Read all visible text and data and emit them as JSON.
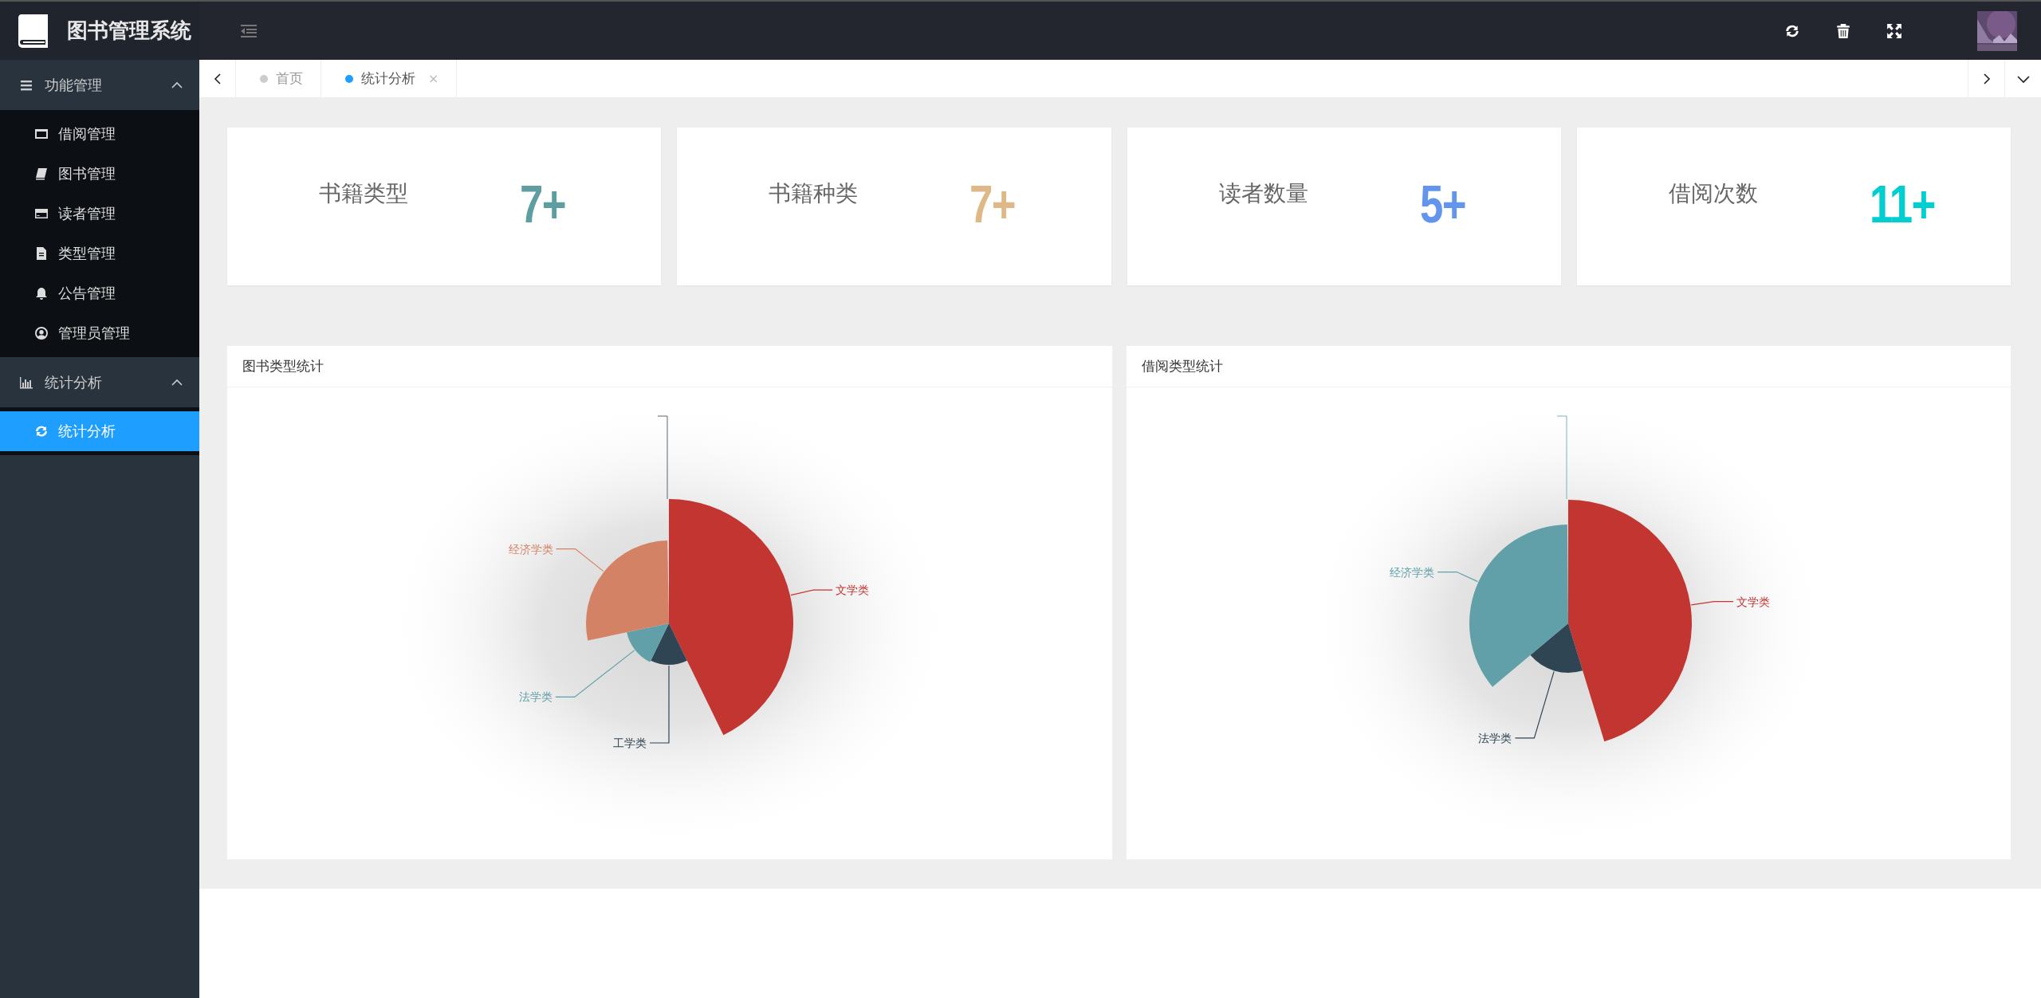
{
  "app_title": "图书管理系统",
  "sidebar": [
    {
      "label": "功能管理",
      "expanded": true,
      "children": [
        {
          "label": "借阅管理",
          "selected": false
        },
        {
          "label": "图书管理",
          "selected": false
        },
        {
          "label": "读者管理",
          "selected": false
        },
        {
          "label": "类型管理",
          "selected": false
        },
        {
          "label": "公告管理",
          "selected": false
        },
        {
          "label": "管理员管理",
          "selected": false
        }
      ]
    },
    {
      "label": "统计分析",
      "expanded": true,
      "children": [
        {
          "label": "统计分析",
          "selected": true
        }
      ]
    }
  ],
  "tabs": [
    {
      "label": "首页",
      "selected": false
    },
    {
      "label": "统计分析",
      "selected": true,
      "close": "×"
    }
  ],
  "stats": [
    {
      "label": "书籍类型",
      "value": "7+",
      "color": "#5f9ea0"
    },
    {
      "label": "书籍种类",
      "value": "7+",
      "color": "#deb887"
    },
    {
      "label": "读者数量",
      "value": "5+",
      "color": "#6495ed"
    },
    {
      "label": "借阅次数",
      "value": "11+",
      "color": "#00ced1"
    }
  ],
  "charts": [
    {
      "title": "图书类型统计",
      "slices": [
        {
          "label": "文学类",
          "color": "#c23531"
        },
        {
          "label": "工学类",
          "color": "#2f4554"
        },
        {
          "label": "法学类",
          "color": "#61a0a8"
        },
        {
          "label": "经济学类",
          "color": "#d48265"
        }
      ]
    },
    {
      "title": "借阅类型统计",
      "slices": [
        {
          "label": "文学类",
          "color": "#c23531"
        },
        {
          "label": "法学类",
          "color": "#2f4554"
        },
        {
          "label": "经济学类",
          "color": "#61a0a8"
        }
      ]
    }
  ]
}
